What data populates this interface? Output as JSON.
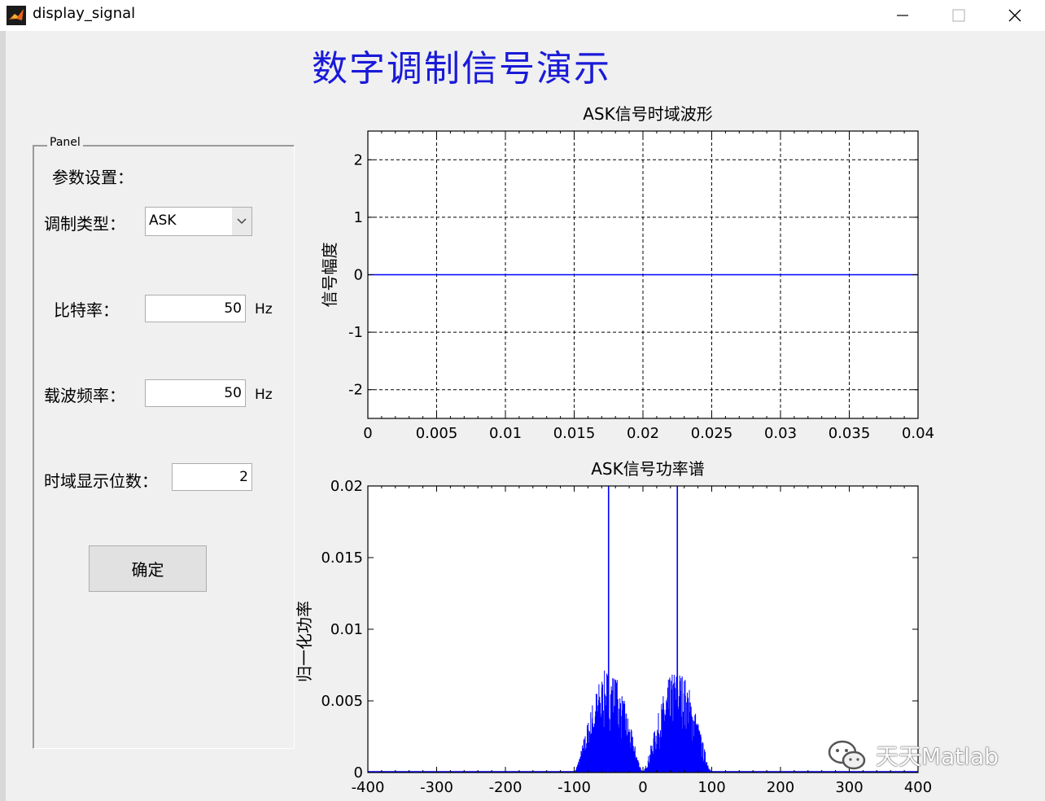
{
  "window": {
    "title": "display_signal"
  },
  "heading": "数字调制信号演示",
  "panel": {
    "title": "Panel",
    "section_label": "参数设置：",
    "mod_type_label": "调制类型：",
    "mod_type_value": "ASK",
    "bitrate_label": "比特率：",
    "bitrate_value": "50",
    "bitrate_unit": "Hz",
    "carrier_label": "载波频率：",
    "carrier_value": "50",
    "carrier_unit": "Hz",
    "digits_label": "时域显示位数：",
    "digits_value": "2",
    "confirm_label": "确定"
  },
  "colors": {
    "heading": "#1a1ad8",
    "series": "#0000ff"
  },
  "watermark": {
    "text": "天天Matlab",
    "icon": "wechat-icon"
  },
  "chart_data": [
    {
      "type": "line",
      "title": "ASK信号时域波形",
      "xlabel": "",
      "ylabel": "信号幅度",
      "xlim": [
        0,
        0.04
      ],
      "ylim": [
        -2.5,
        2.5
      ],
      "xticks": [
        0,
        0.005,
        0.01,
        0.015,
        0.02,
        0.025,
        0.03,
        0.035,
        0.04
      ],
      "xtick_labels": [
        "0",
        "0.005",
        "0.01",
        "0.015",
        "0.02",
        "0.025",
        "0.03",
        "0.035",
        "0.04"
      ],
      "yticks": [
        2,
        1,
        0,
        -1,
        -2
      ],
      "ytick_labels": [
        "2",
        "1",
        "0",
        "-1",
        "-2"
      ],
      "grid": true,
      "series": [
        {
          "x": [
            0,
            0.04
          ],
          "y": [
            0,
            0
          ]
        }
      ]
    },
    {
      "type": "line",
      "title": "ASK信号功率谱",
      "xlabel": "",
      "ylabel": "归一化功率",
      "xlim": [
        -400,
        400
      ],
      "ylim": [
        0,
        0.02
      ],
      "xticks": [
        -400,
        -300,
        -200,
        -100,
        0,
        100,
        200,
        300,
        400
      ],
      "xtick_labels": [
        "-400",
        "-300",
        "-200",
        "-100",
        "0",
        "100",
        "200",
        "300",
        "400"
      ],
      "yticks": [
        0.02,
        0.015,
        0.01,
        0.005,
        0
      ],
      "ytick_labels": [
        "0.02",
        "0.015",
        "0.01",
        "0.005",
        "0"
      ],
      "grid": false,
      "peaks": [
        {
          "x": -50,
          "y": 0.02
        },
        {
          "x": 50,
          "y": 0.02
        }
      ],
      "lobes": [
        {
          "center": -50,
          "halfwidth": 50,
          "height": 0.0073
        },
        {
          "center": 50,
          "halfwidth": 50,
          "height": 0.0073
        }
      ]
    }
  ]
}
